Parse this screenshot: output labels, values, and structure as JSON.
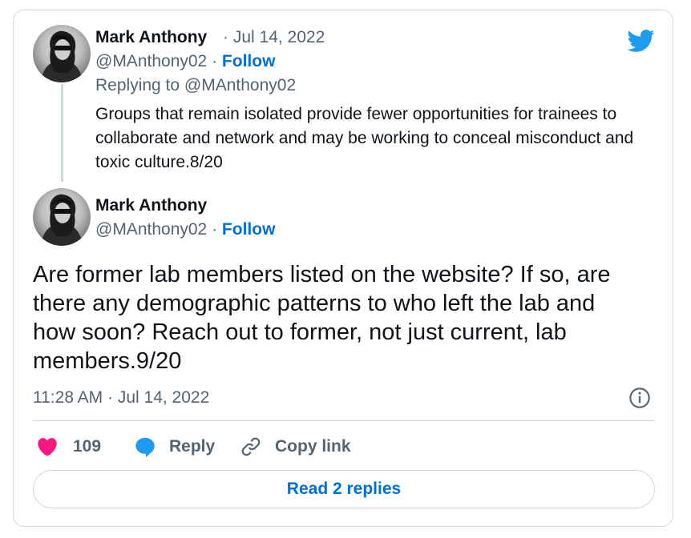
{
  "reply_tweet": {
    "author_name": "Mark Anthony",
    "date_separator": "·",
    "date": "Jul 14, 2022",
    "handle": "@MAnthony02",
    "follow_separator": "·",
    "follow_label": "Follow",
    "replying_to_prefix": "Replying to",
    "replying_to_handle": "@MAnthony02",
    "text": "Groups that remain isolated provide fewer opportunities for trainees to collaborate and network and may be working to conceal misconduct and toxic culture.8/20"
  },
  "main_tweet": {
    "author_name": "Mark Anthony",
    "handle": "@MAnthony02",
    "follow_separator": "·",
    "follow_label": "Follow",
    "text": "Are former lab members listed on the website? If so, are there any demographic patterns to who left the lab and how soon? Reach out to former, not just current, lab members.9/20",
    "timestamp": "11:28 AM · Jul 14, 2022"
  },
  "actions": {
    "like_count": "109",
    "reply_label": "Reply",
    "copy_link_label": "Copy link",
    "read_replies_label": "Read 2 replies"
  },
  "icons": {
    "logo": "twitter-bird-icon",
    "like": "heart-icon",
    "reply": "speech-bubble-icon",
    "copy_link": "link-icon",
    "info": "info-icon"
  },
  "colors": {
    "accent": "#006fd6",
    "twitter_blue": "#1d9bf0",
    "like": "#f91880",
    "secondary_text": "#536471",
    "border": "#cfd9de"
  }
}
